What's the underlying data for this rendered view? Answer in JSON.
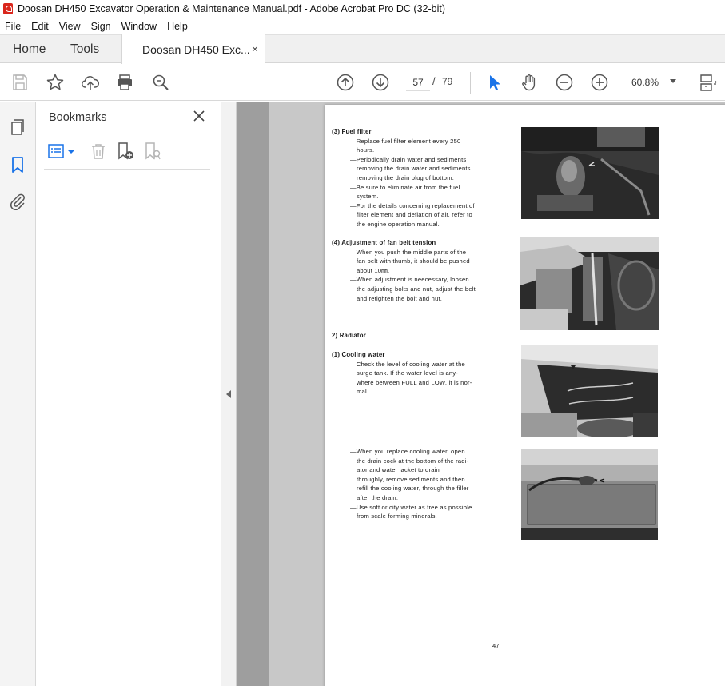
{
  "window": {
    "title": "Doosan DH450 Excavator Operation & Maintenance Manual.pdf - Adobe Acrobat Pro DC (32-bit)"
  },
  "menu": [
    "File",
    "Edit",
    "View",
    "Sign",
    "Window",
    "Help"
  ],
  "tabs": {
    "home": "Home",
    "tools": "Tools",
    "document": "Doosan DH450 Exc...",
    "close": "×"
  },
  "toolbar": {
    "page_current": "57",
    "page_separator": "/",
    "page_total": "79",
    "zoom": "60.8%"
  },
  "bookmarks": {
    "title": "Bookmarks"
  },
  "document": {
    "sections": [
      {
        "heading": "(3)  Fuel filter",
        "lines": [
          "—Replace fuel filter element every 250",
          "hours.",
          "—Periodically drain water and sediments",
          "removing the drain water and sediments",
          "removing the drain plug of bottom.",
          "—Be sure to eliminate air from the fuel",
          "system.",
          "—For the details concerning replacement of",
          "filter element and deflation of air, refer to",
          "the engine operation manual."
        ]
      },
      {
        "heading": "(4)  Adjustment of fan belt tension",
        "lines": [
          "—When you push the middle parts of the",
          "fan belt with thumb, it should be pushed",
          "about 10㎜.",
          "—When adjustment is neecessary, loosen",
          "the adjusting bolts and nut, adjust the belt",
          "and retighten the bolt and nut."
        ]
      },
      {
        "heading": "2)  Radiator",
        "lines": []
      },
      {
        "heading": "(1)  Cooling water",
        "lines": [
          "—Check the level of cooling water at the",
          "surge tank. If the water level is any-",
          "where between FULL and LOW. it is nor-",
          "mal."
        ]
      },
      {
        "heading": "",
        "lines": [
          "—When you replace cooling water, open",
          "the drain cock at the bottom of the radi-",
          "ator and water jacket to drain",
          "throughly, remove sediments and then",
          "refill the cooling water, through the filler",
          "after the drain.",
          "—Use soft or city water as free as possible",
          "from scale forming minerals."
        ]
      }
    ],
    "page_number": "47"
  },
  "colors": {
    "accent_blue": "#1a73e8",
    "acrobat_red": "#d9261c",
    "viewport_gray": "#9e9e9e"
  }
}
